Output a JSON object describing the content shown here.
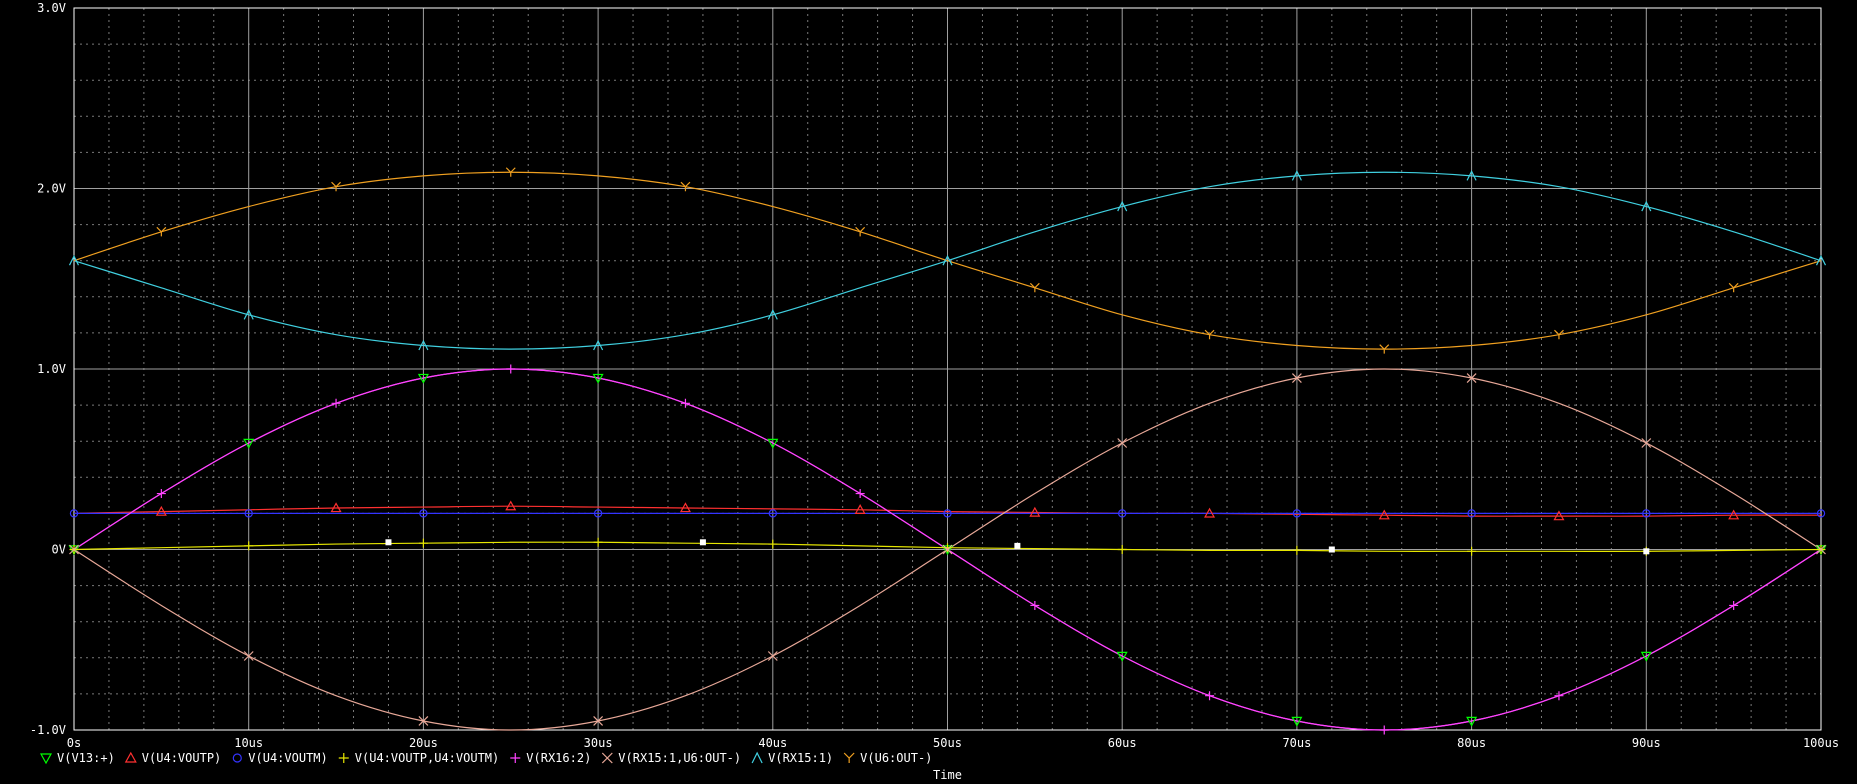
{
  "chart_data": {
    "type": "line",
    "title": "",
    "xlabel": "Time",
    "ylabel": "",
    "xlim": [
      0,
      100
    ],
    "ylim": [
      -1.0,
      3.0
    ],
    "x_ticks": [
      0,
      10,
      20,
      30,
      40,
      50,
      60,
      70,
      80,
      90,
      100
    ],
    "x_tick_labels": [
      "0s",
      "10us",
      "20us",
      "30us",
      "40us",
      "50us",
      "60us",
      "70us",
      "80us",
      "90us",
      "100us"
    ],
    "y_ticks": [
      -1,
      0,
      1,
      2,
      3
    ],
    "y_tick_labels": [
      "-1.0V",
      "0V",
      "1.0V",
      "2.0V",
      "3.0V"
    ],
    "grid": true,
    "legend_placement": "bottom",
    "colors": {
      "background": "#000000",
      "grid_major": "#a0a0a0",
      "grid_minor": "#7a7a7a",
      "axis": "#ffffff"
    },
    "x": [
      0,
      5,
      10,
      15,
      20,
      25,
      30,
      35,
      40,
      45,
      50,
      55,
      60,
      65,
      70,
      75,
      80,
      85,
      90,
      95,
      100
    ],
    "series": [
      {
        "name": "V(V13:+)",
        "marker": "triangle-down",
        "color": "#00ff00",
        "line_color": "#ff44ff",
        "values": [
          0,
          0.31,
          0.59,
          0.81,
          0.95,
          1.0,
          0.95,
          0.81,
          0.59,
          0.31,
          0,
          -0.31,
          -0.59,
          -0.81,
          -0.95,
          -1.0,
          -0.95,
          -0.81,
          -0.59,
          -0.31,
          0
        ]
      },
      {
        "name": "V(U4:VOUTP)",
        "marker": "triangle-up",
        "color": "#ff3030",
        "values": [
          0.2,
          0.21,
          0.22,
          0.23,
          0.235,
          0.24,
          0.235,
          0.23,
          0.225,
          0.22,
          0.21,
          0.205,
          0.2,
          0.2,
          0.195,
          0.19,
          0.185,
          0.185,
          0.185,
          0.19,
          0.19
        ]
      },
      {
        "name": "V(U4:VOUTM)",
        "marker": "circle",
        "color": "#3333ff",
        "values": [
          0.2,
          0.2,
          0.2,
          0.2,
          0.2,
          0.2,
          0.2,
          0.2,
          0.2,
          0.2,
          0.2,
          0.2,
          0.2,
          0.2,
          0.2,
          0.2,
          0.2,
          0.2,
          0.2,
          0.2,
          0.2
        ]
      },
      {
        "name": "V(U4:VOUTP,U4:VOUTM)",
        "marker": "plus",
        "color": "#e6e600",
        "values": [
          0,
          0.01,
          0.02,
          0.03,
          0.035,
          0.04,
          0.04,
          0.035,
          0.03,
          0.02,
          0.01,
          0.005,
          0,
          -0.005,
          -0.005,
          -0.01,
          -0.01,
          -0.01,
          -0.01,
          -0.005,
          0
        ]
      },
      {
        "name": "V(RX16:2)",
        "marker": "plus",
        "color": "#ff44ff",
        "values": [
          0,
          0.31,
          0.59,
          0.81,
          0.95,
          1.0,
          0.95,
          0.81,
          0.59,
          0.31,
          0,
          -0.31,
          -0.59,
          -0.81,
          -0.95,
          -1.0,
          -0.95,
          -0.81,
          -0.59,
          -0.31,
          0
        ]
      },
      {
        "name": "V(RX15:1,U6:OUT-)",
        "marker": "x",
        "color": "#e8a898",
        "values": [
          0,
          -0.31,
          -0.59,
          -0.81,
          -0.95,
          -1.0,
          -0.95,
          -0.81,
          -0.59,
          -0.31,
          0,
          0.31,
          0.59,
          0.81,
          0.95,
          1.0,
          0.95,
          0.81,
          0.59,
          0.31,
          0
        ]
      },
      {
        "name": "V(RX15:1)",
        "marker": "lambda",
        "color": "#40d0e0",
        "values": [
          1.6,
          1.45,
          1.3,
          1.19,
          1.13,
          1.11,
          1.13,
          1.19,
          1.3,
          1.45,
          1.6,
          1.76,
          1.9,
          2.01,
          2.07,
          2.09,
          2.07,
          2.01,
          1.9,
          1.76,
          1.6
        ]
      },
      {
        "name": "V(U6:OUT-)",
        "marker": "y",
        "color": "#f0a020",
        "values": [
          1.6,
          1.76,
          1.9,
          2.01,
          2.07,
          2.09,
          2.07,
          2.01,
          1.9,
          1.76,
          1.6,
          1.45,
          1.3,
          1.19,
          1.13,
          1.11,
          1.13,
          1.19,
          1.3,
          1.45,
          1.6
        ]
      }
    ],
    "square_markers": {
      "color": "#ffffff",
      "points": [
        [
          18,
          0.04
        ],
        [
          36,
          0.04
        ],
        [
          54,
          0.02
        ],
        [
          72,
          0.0
        ],
        [
          90,
          -0.01
        ]
      ]
    }
  }
}
